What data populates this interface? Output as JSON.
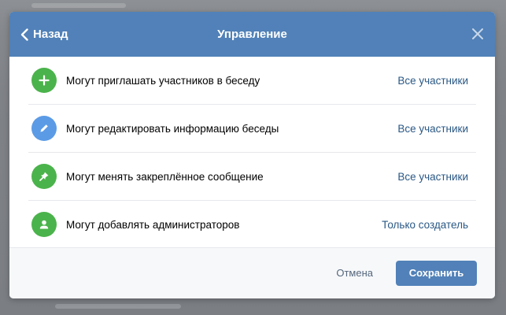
{
  "header": {
    "back_label": "Назад",
    "title": "Управление"
  },
  "rows": [
    {
      "label": "Могут приглашать участников в беседу",
      "value": "Все участники",
      "icon": "plus-icon",
      "icon_color": "#4bb34b"
    },
    {
      "label": "Могут редактировать информацию беседы",
      "value": "Все участники",
      "icon": "pencil-icon",
      "icon_color": "#5b9be6"
    },
    {
      "label": "Могут менять закреплённое сообщение",
      "value": "Все участники",
      "icon": "pin-icon",
      "icon_color": "#4bb34b"
    },
    {
      "label": "Могут добавлять администраторов",
      "value": "Только создатель",
      "icon": "user-icon",
      "icon_color": "#4bb34b"
    }
  ],
  "footer": {
    "cancel_label": "Отмена",
    "save_label": "Сохранить"
  },
  "colors": {
    "header_bg": "#5181b8",
    "link": "#2a5885",
    "save_button": "#5181b8"
  }
}
